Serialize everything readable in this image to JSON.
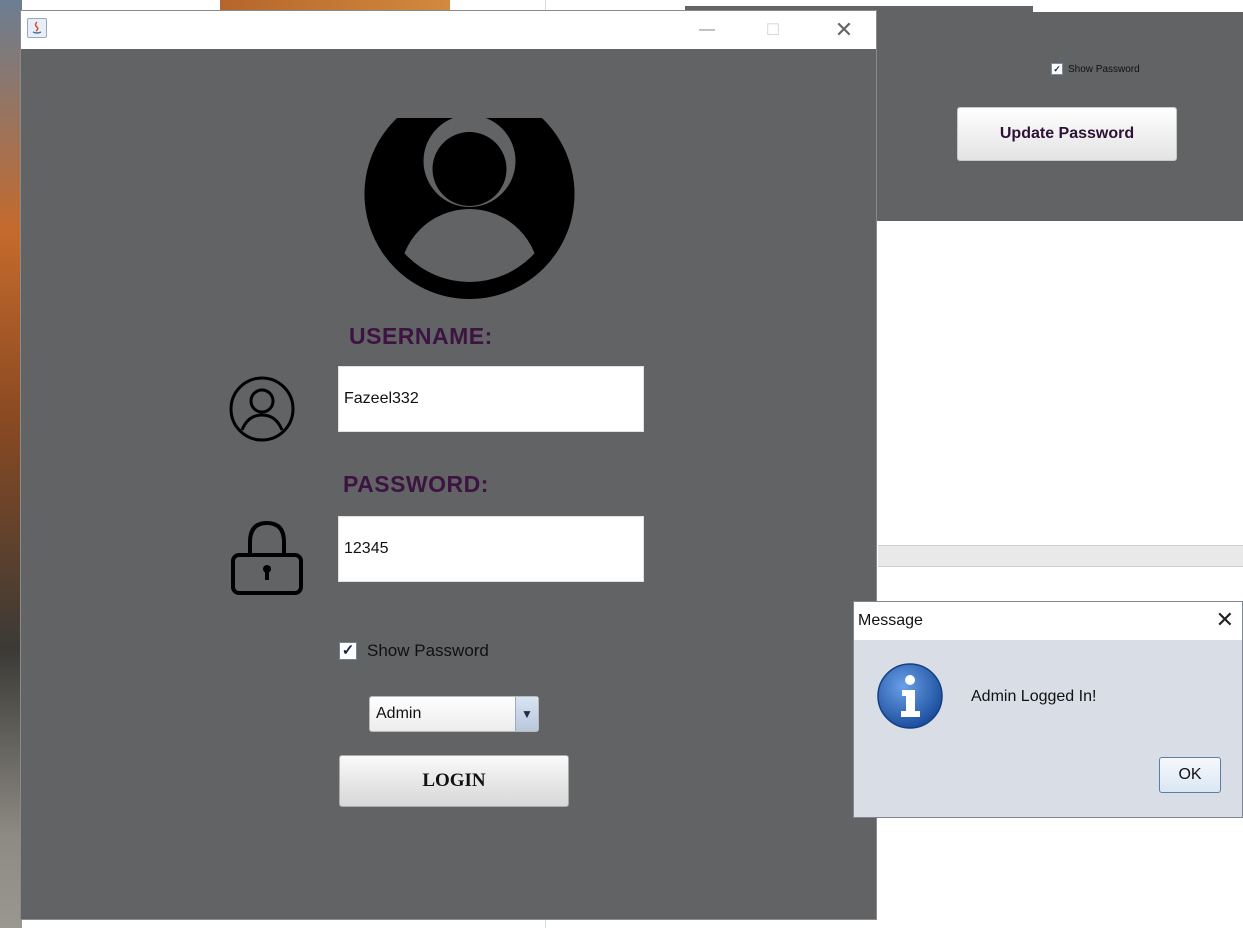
{
  "login_window": {
    "avatar_icon": "user-avatar-icon",
    "username_label": "USERNAME:",
    "username_value": "Fazeel332",
    "password_label": "PASSWORD:",
    "password_value": "12345",
    "show_password_label": "Show Password",
    "show_password_checked": true,
    "role_selected": "Admin",
    "login_label": "LOGIN"
  },
  "background_window": {
    "show_password_label": "Show Password",
    "update_password_label": "Update Password"
  },
  "dialog": {
    "title": "Message",
    "message": "Admin Logged In!",
    "ok_label": "OK"
  },
  "colors": {
    "panel_bg": "#626365",
    "heading_text": "#3d1342"
  }
}
